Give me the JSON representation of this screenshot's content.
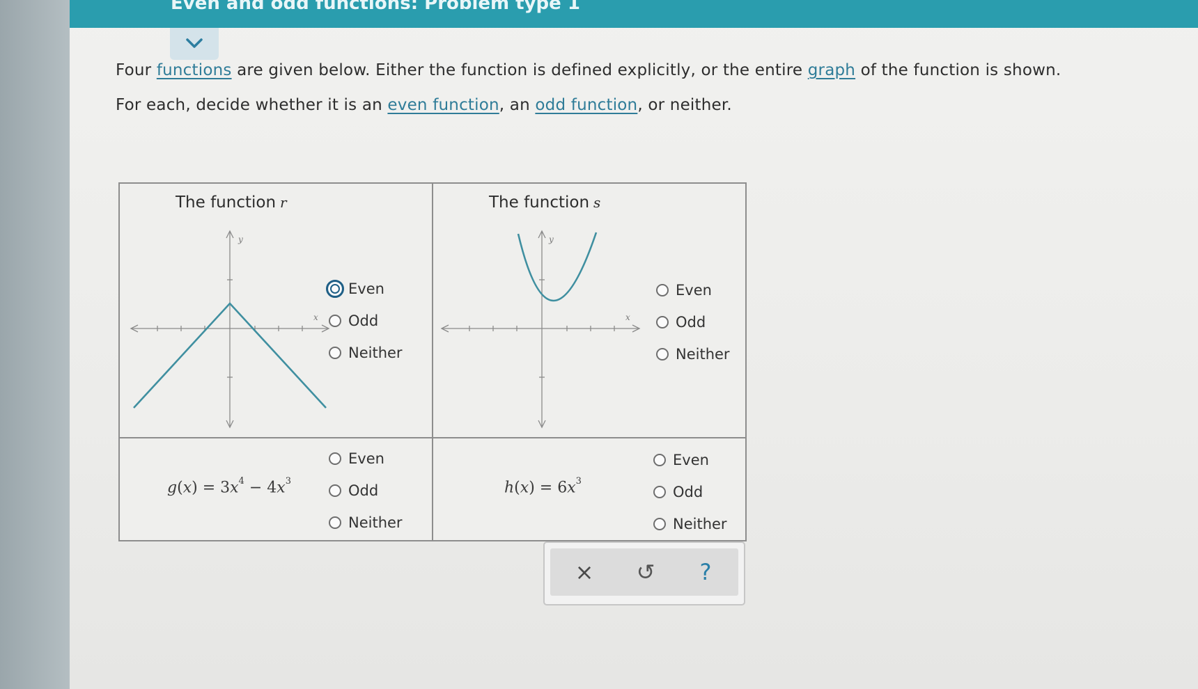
{
  "header": {
    "title": "Even and odd functions: Problem type 1"
  },
  "instructions": {
    "line1": {
      "part1": "Four ",
      "link_functions": "functions",
      "part2": " are given below. Either the function is defined explicitly, or the entire ",
      "link_graph": "graph",
      "part3": " of the function is shown."
    },
    "line2": {
      "part1": "For each, decide whether it is an ",
      "link_even": "even function",
      "part2": ", an ",
      "link_odd": "odd function",
      "part3": ", or neither."
    }
  },
  "problems": {
    "r": {
      "title": "The function",
      "name": "r",
      "options": [
        "Even",
        "Odd",
        "Neither"
      ],
      "focused_option": "Even"
    },
    "s": {
      "title": "The function",
      "name": "s",
      "options": [
        "Even",
        "Odd",
        "Neither"
      ]
    },
    "g": {
      "lhs_fn": "g",
      "lhs_var": "x",
      "eq": "=",
      "coef1": "3",
      "var1": "x",
      "exp1": "4",
      "minus": "−",
      "coef2": "4",
      "var2": "x",
      "exp2": "3",
      "options": [
        "Even",
        "Odd",
        "Neither"
      ]
    },
    "h": {
      "lhs_fn": "h",
      "lhs_var": "x",
      "eq": "=",
      "coef1": "6",
      "var1": "x",
      "exp1": "3",
      "options": [
        "Even",
        "Odd",
        "Neither"
      ]
    }
  },
  "graph_labels": {
    "x": "x",
    "y": "y"
  },
  "toolbar": {
    "clear": "×",
    "undo": "↺",
    "help": "?"
  },
  "colors": {
    "accent": "#2a9dae",
    "curve": "#3f8fa0",
    "link": "#2f7c98",
    "focus": "#1f5f86"
  }
}
